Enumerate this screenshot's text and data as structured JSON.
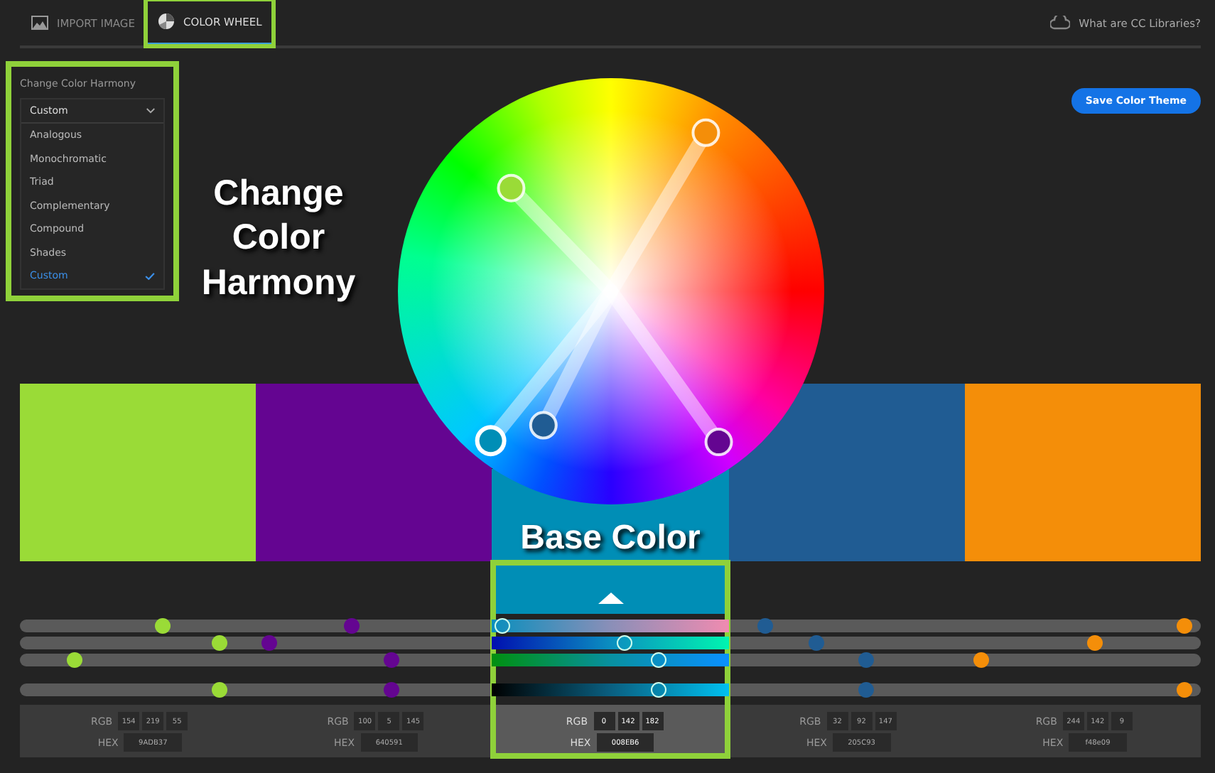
{
  "tabs": [
    {
      "label": "IMPORT IMAGE",
      "selected": false,
      "highlighted": false
    },
    {
      "label": "COLOR WHEEL",
      "selected": true,
      "highlighted": true
    }
  ],
  "help_link": "What are CC Libraries?",
  "harmony": {
    "title": "Change Color Harmony",
    "value": "Custom",
    "highlighted": true,
    "options": [
      {
        "label": "Analogous",
        "selected": false
      },
      {
        "label": "Monochromatic",
        "selected": false
      },
      {
        "label": "Triad",
        "selected": false
      },
      {
        "label": "Complementary",
        "selected": false
      },
      {
        "label": "Compound",
        "selected": false
      },
      {
        "label": "Shades",
        "selected": false
      },
      {
        "label": "Custom",
        "selected": true
      }
    ]
  },
  "annotations": [
    {
      "kind": "harmony",
      "text": "Change Color Harmony"
    },
    {
      "kind": "base",
      "text": "Base Color"
    }
  ],
  "save_button": "Save Color Theme",
  "swatches": [
    {
      "color": "#9adb37",
      "rgb_label": "RGB",
      "hex_label": "HEX",
      "rgb": [
        "154",
        "219",
        "55"
      ],
      "hex": "9ADB37",
      "selected": false,
      "highlighted": false,
      "sliders": [
        {
          "level": 0.6
        },
        {
          "level": 0.84
        },
        {
          "level": 0.23
        },
        {
          "level": 0.84
        }
      ]
    },
    {
      "color": "#640591",
      "rgb_label": "RGB",
      "hex_label": "HEX",
      "rgb": [
        "100",
        "5",
        "145"
      ],
      "hex": "640591",
      "selected": false,
      "highlighted": false,
      "sliders": [
        {
          "level": 0.4
        },
        {
          "level": 0.05
        },
        {
          "level": 0.57
        },
        {
          "level": 0.57
        }
      ]
    },
    {
      "color": "#008eb6",
      "rgb_label": "RGB",
      "hex_label": "HEX",
      "rgb": [
        "0",
        "142",
        "182"
      ],
      "hex": "008EB6",
      "selected": true,
      "highlighted": true,
      "sliders": [
        {
          "level": 0.04
        },
        {
          "level": 0.56
        },
        {
          "level": 0.7
        },
        {
          "level": 0.7
        }
      ]
    },
    {
      "color": "#205c93",
      "rgb_label": "RGB",
      "hex_label": "HEX",
      "rgb": [
        "32",
        "92",
        "147"
      ],
      "hex": "205C93",
      "selected": false,
      "highlighted": false,
      "sliders": [
        {
          "level": 0.15
        },
        {
          "level": 0.37
        },
        {
          "level": 0.58
        },
        {
          "level": 0.58
        }
      ]
    },
    {
      "color": "#f48e09",
      "rgb_label": "RGB",
      "hex_label": "HEX",
      "rgb": [
        "244",
        "142",
        "9"
      ],
      "hex": "f48e09",
      "selected": false,
      "highlighted": false,
      "sliders": [
        {
          "level": 0.93
        },
        {
          "level": 0.55
        },
        {
          "level": 0.07
        },
        {
          "level": 0.93
        }
      ]
    }
  ]
}
